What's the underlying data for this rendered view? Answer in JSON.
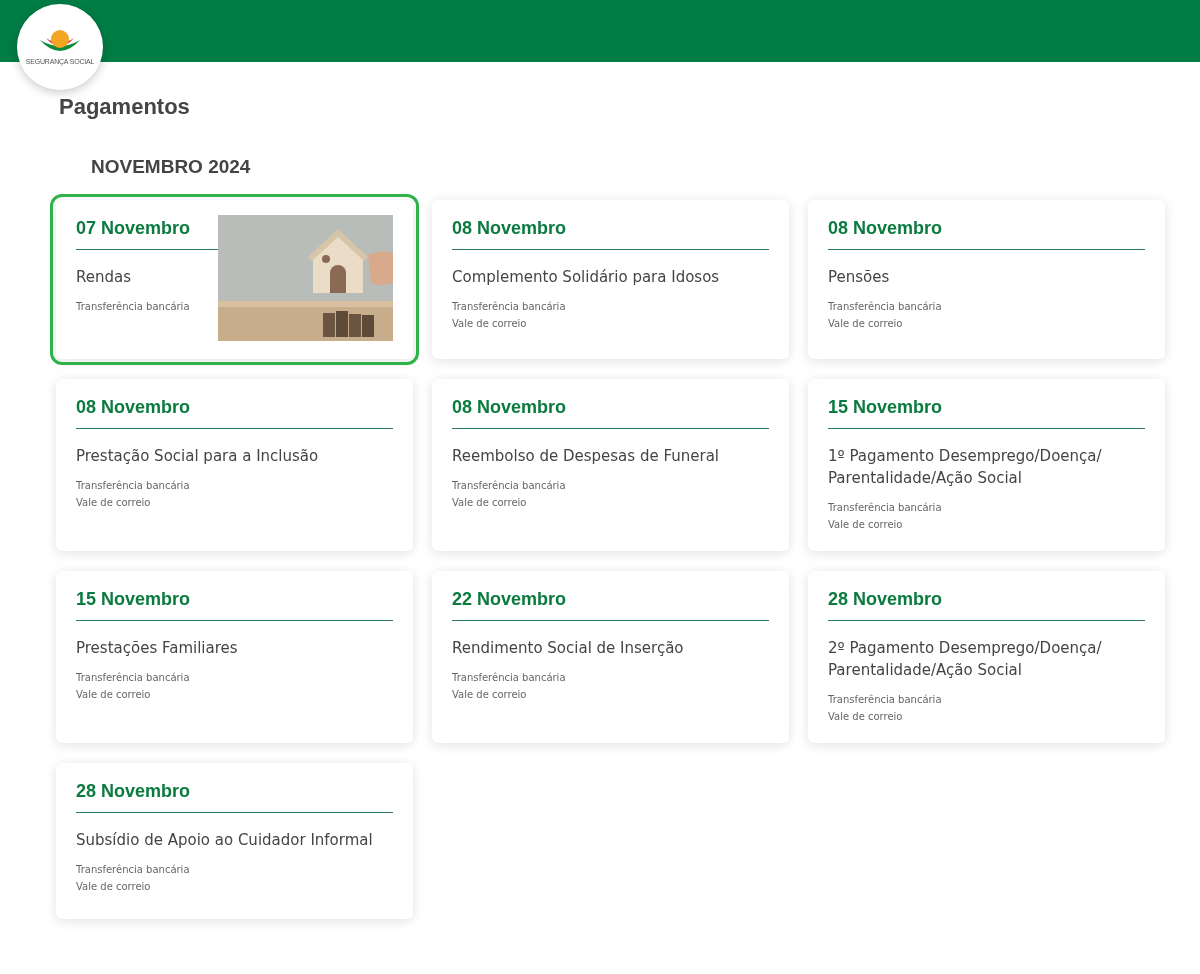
{
  "logo": {
    "text": "SEGURANÇA SOCIAL"
  },
  "page_title": "Pagamentos",
  "month": "NOVEMBRO 2024",
  "cards": [
    {
      "date": "07 Novembro",
      "title": "Rendas",
      "methods": [
        "Transferência bancária"
      ],
      "selected": true,
      "kind": "picture"
    },
    {
      "date": "08 Novembro",
      "title": "Complemento Solidário para Idosos",
      "methods": [
        "Transferência bancária",
        "Vale de correio"
      ],
      "selected": false,
      "kind": "text"
    },
    {
      "date": "08 Novembro",
      "title": "Pensões",
      "methods": [
        "Transferência bancária",
        "Vale de correio"
      ],
      "selected": false,
      "kind": "text"
    },
    {
      "date": "08 Novembro",
      "title": "Prestação Social para a Inclusão",
      "methods": [
        "Transferência bancária",
        "Vale de correio"
      ],
      "selected": false,
      "kind": "text"
    },
    {
      "date": "08 Novembro",
      "title": "Reembolso de Despesas de Funeral",
      "methods": [
        "Transferência bancária",
        "Vale de correio"
      ],
      "selected": false,
      "kind": "text"
    },
    {
      "date": "15 Novembro",
      "title": "1º Pagamento Desemprego/Doença/ Parentalidade/Ação Social",
      "methods": [
        "Transferência bancária",
        "Vale de correio"
      ],
      "selected": false,
      "kind": "text"
    },
    {
      "date": "15 Novembro",
      "title": "Prestações Familiares",
      "methods": [
        "Transferência bancária",
        "Vale de correio"
      ],
      "selected": false,
      "kind": "text"
    },
    {
      "date": "22 Novembro",
      "title": "Rendimento Social de Inserção",
      "methods": [
        "Transferência bancária",
        "Vale de correio"
      ],
      "selected": false,
      "kind": "text"
    },
    {
      "date": "28 Novembro",
      "title": "2º Pagamento Desemprego/Doença/ Parentalidade/Ação Social",
      "methods": [
        "Transferência bancária",
        "Vale de correio"
      ],
      "selected": false,
      "kind": "text"
    },
    {
      "date": "28 Novembro",
      "title": "Subsídio de Apoio ao Cuidador Informal",
      "methods": [
        "Transferência bancária",
        "Vale de correio"
      ],
      "selected": false,
      "kind": "text"
    }
  ]
}
